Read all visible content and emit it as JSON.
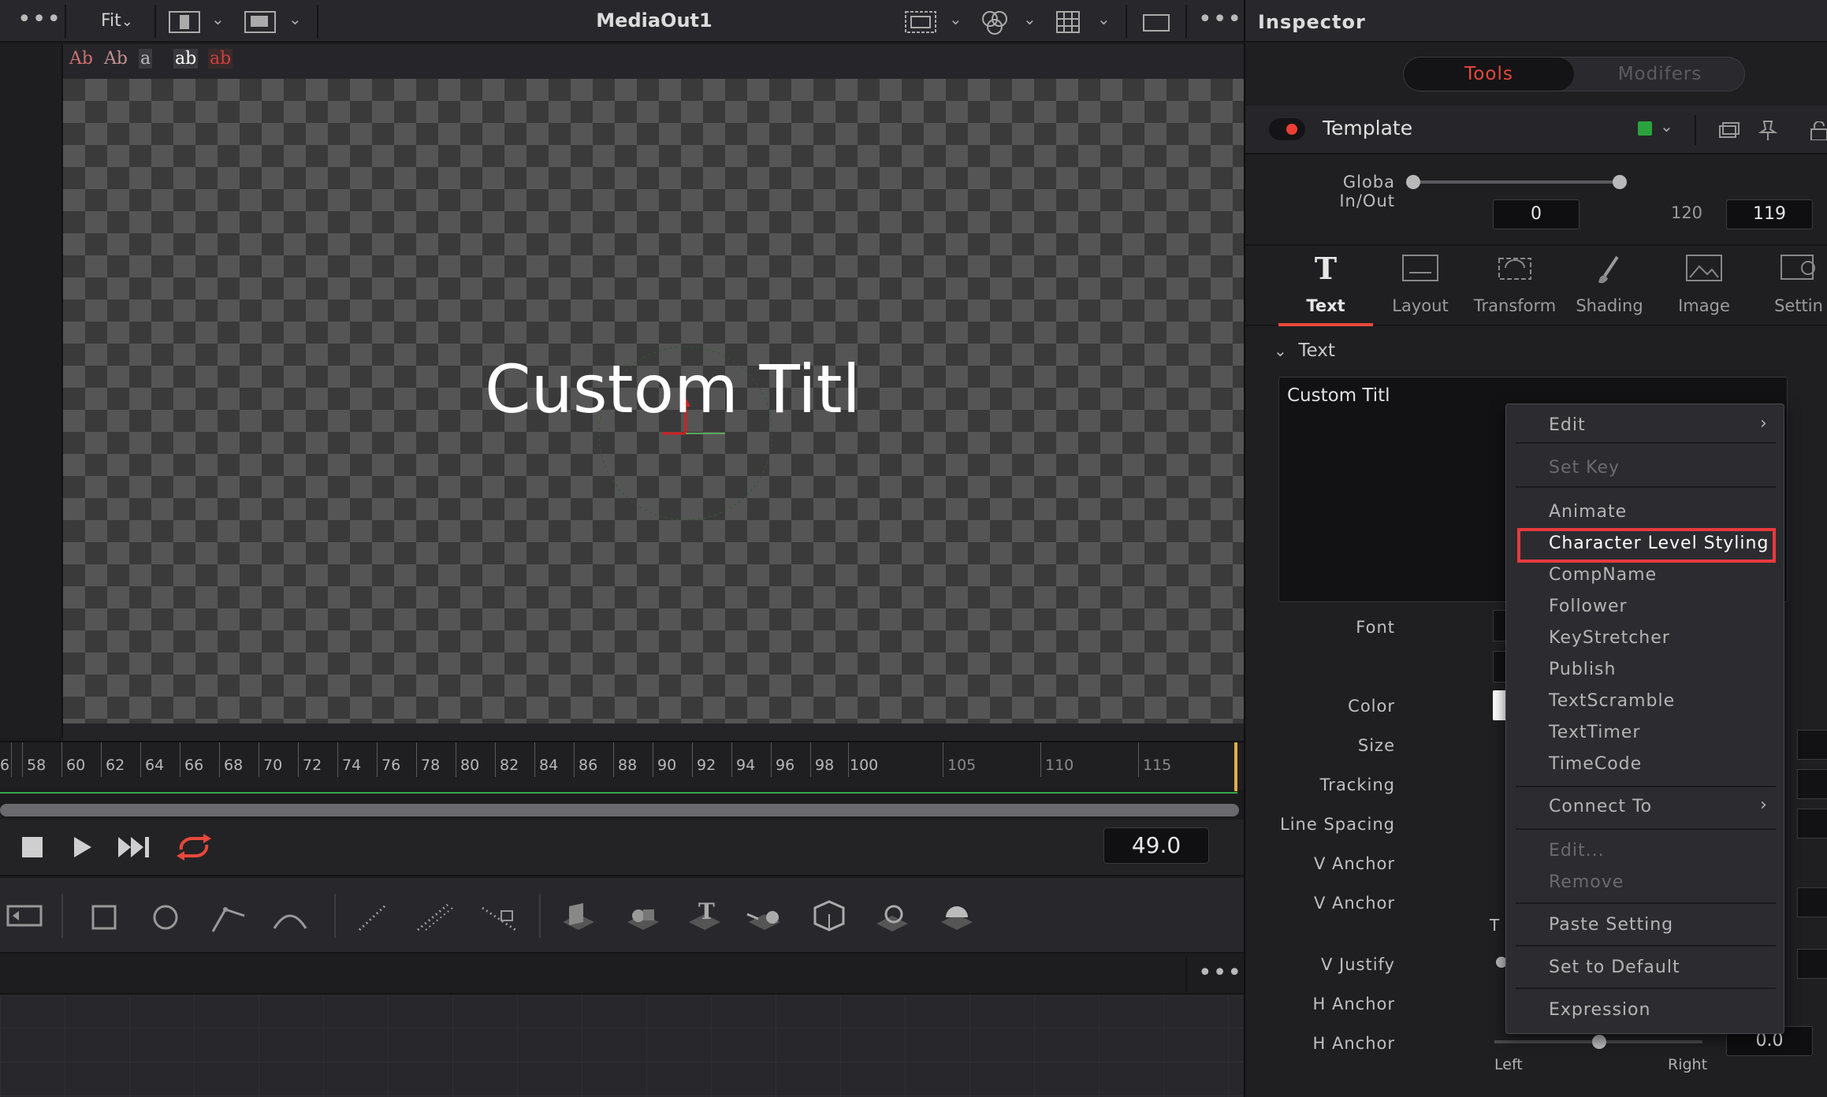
{
  "viewer": {
    "title": "MediaOut1",
    "fit_label": "Fit",
    "text_tools": [
      "Ab",
      "Ab",
      "a",
      "ab",
      "ab"
    ],
    "canvas_text": "Custom Titl"
  },
  "ruler": {
    "labels": [
      "6",
      "58",
      "60",
      "62",
      "64",
      "66",
      "68",
      "70",
      "72",
      "74",
      "76",
      "78",
      "80",
      "82",
      "84",
      "86",
      "88",
      "90",
      "92",
      "94",
      "96",
      "98",
      "100",
      "105",
      "110",
      "115"
    ]
  },
  "transport": {
    "current_time": "49.0"
  },
  "inspector": {
    "title": "Inspector",
    "seg_tools": "Tools",
    "seg_modifiers": "Modifers",
    "template_name": "Template",
    "template_color": "#2aa33c",
    "global_label": "Globa  In/Out",
    "global_in": "0",
    "global_mid": "120",
    "global_out": "119",
    "tabs": [
      {
        "label": "Text",
        "icon": "text-icon"
      },
      {
        "label": "Layout",
        "icon": "layout-icon"
      },
      {
        "label": "Transform",
        "icon": "transform-icon"
      },
      {
        "label": "Shading",
        "icon": "shading-icon"
      },
      {
        "label": "Image",
        "icon": "image-icon"
      },
      {
        "label": "Settin",
        "icon": "settings-icon"
      }
    ],
    "section_title": "Text",
    "styled_text": "Custom Titl",
    "prop_labels": {
      "font": "Font",
      "color": "Color",
      "size": "Size",
      "tracking": "Tracking",
      "line_spacing": "Line Spacing",
      "v_anchor_1": "V Anchor",
      "v_anchor_2": "V Anchor",
      "v_justify": "V Justify",
      "h_anchor_1": "H Anchor",
      "h_anchor_2": "H Anchor"
    },
    "h_anchor_value": "0.0",
    "h_anchor_left": "Left",
    "h_anchor_right": "Right",
    "t_fragment": "T"
  },
  "context_menu": {
    "items": [
      {
        "label": "Edit",
        "submenu": true,
        "disabled": false
      },
      {
        "label": "Set Key",
        "disabled": true
      },
      {
        "label": "Animate",
        "disabled": false
      },
      {
        "label": "Character Level Styling",
        "disabled": false,
        "highlighted": true
      },
      {
        "label": "CompName",
        "disabled": false
      },
      {
        "label": "Follower",
        "disabled": false
      },
      {
        "label": "KeyStretcher",
        "disabled": false
      },
      {
        "label": "Publish",
        "disabled": false
      },
      {
        "label": "TextScramble",
        "disabled": false
      },
      {
        "label": "TextTimer",
        "disabled": false
      },
      {
        "label": "TimeCode",
        "disabled": false
      },
      {
        "label": "Connect To",
        "submenu": true,
        "disabled": false
      },
      {
        "label": "Edit...",
        "disabled": true
      },
      {
        "label": "Remove",
        "disabled": true
      },
      {
        "label": "Paste Setting",
        "disabled": false
      },
      {
        "label": "Set to Default",
        "disabled": false
      },
      {
        "label": "Expression",
        "disabled": false
      }
    ],
    "highlight_color": "#e83a3f"
  },
  "colors": {
    "accent_red": "#e8483c",
    "playhead_yellow": "#e0b040",
    "timeline_green": "#39a84a"
  }
}
